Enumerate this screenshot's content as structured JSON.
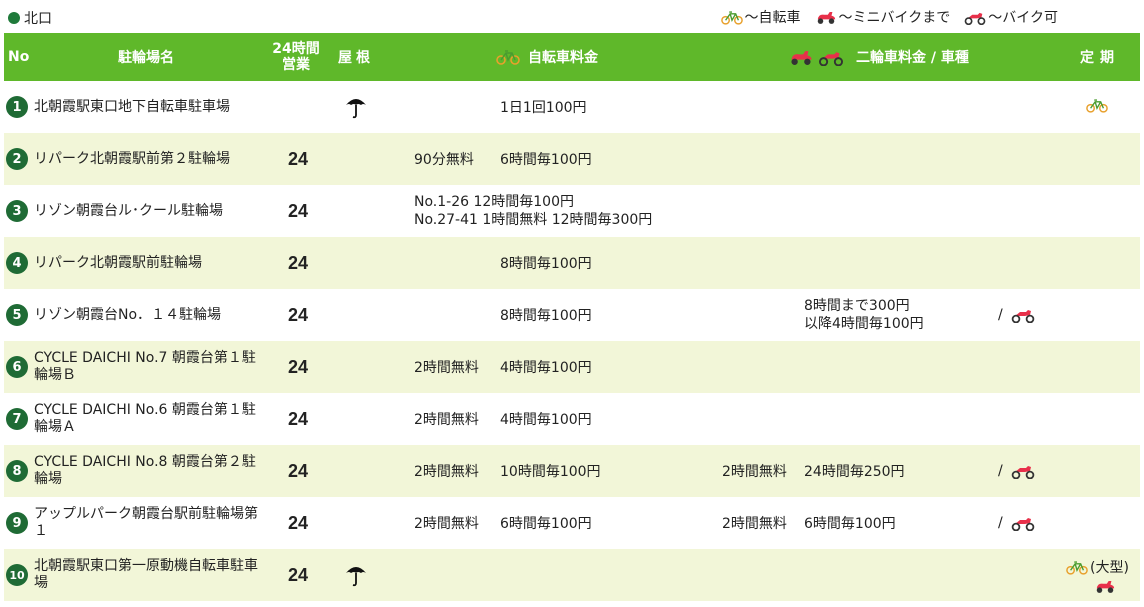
{
  "area_label": "北口",
  "legend": [
    {
      "icon": "bicycle-icon",
      "label": "～自転車"
    },
    {
      "icon": "mini-bike-icon",
      "label": "～ミニバイクまで"
    },
    {
      "icon": "motorbike-icon",
      "label": "～バイク可"
    }
  ],
  "header": {
    "no": "No",
    "name": "駐輪場名",
    "hours_line1": "24時間",
    "hours_line2": "営業",
    "roof": "屋根",
    "bicycle_fee": "自転車料金",
    "moto_fee": "二輪車料金 / 車種",
    "pass": "定期"
  },
  "colors": {
    "header_bg": "#5fb82a",
    "alt_row": "#f2f6d8",
    "number_badge": "#1f6b35",
    "accent_red": "#e8304a"
  },
  "rows": [
    {
      "no": "1",
      "name": "北朝霞駅東口地下自転車駐車場",
      "h24": "",
      "roof": true,
      "bike_fee_1": "",
      "bike_fee_2": "1日1回100円",
      "moto_fee_1": "",
      "moto_fee_2": "",
      "moto_type": "",
      "pass": "bicycle-icon"
    },
    {
      "no": "2",
      "name": "リパーク北朝霞駅前第２駐輪場",
      "h24": "24",
      "roof": false,
      "bike_fee_1": "90分無料",
      "bike_fee_2": "6時間毎100円",
      "moto_fee_1": "",
      "moto_fee_2": "",
      "moto_type": "",
      "pass": ""
    },
    {
      "no": "3",
      "name": "リゾン朝霞台ル･クール駐輪場",
      "h24": "24",
      "roof": false,
      "bike_fee_line1": "No.1-26 12時間毎100円",
      "bike_fee_line2": "No.27-41 1時間無料 12時間毎300円",
      "moto_fee_1": "",
      "moto_fee_2": "",
      "moto_type": "",
      "pass": ""
    },
    {
      "no": "4",
      "name": "リパーク北朝霞駅前駐輪場",
      "h24": "24",
      "roof": false,
      "bike_fee_1": "",
      "bike_fee_2": "8時間毎100円",
      "moto_fee_1": "",
      "moto_fee_2": "",
      "moto_type": "",
      "pass": ""
    },
    {
      "no": "5",
      "name": "リゾン朝霞台No．１４駐輪場",
      "h24": "24",
      "roof": false,
      "bike_fee_1": "",
      "bike_fee_2": "8時間毎100円",
      "moto_fee_line1": "8時間まで300円",
      "moto_fee_line2": "以降4時間毎100円",
      "moto_type": "/",
      "moto_icon": "motorbike-icon",
      "pass": ""
    },
    {
      "no": "6",
      "name": "CYCLE DAICHI No.7 朝霞台第１駐輪場Ｂ",
      "h24": "24",
      "roof": false,
      "bike_fee_1": "2時間無料",
      "bike_fee_2": "4時間毎100円",
      "moto_fee_1": "",
      "moto_fee_2": "",
      "moto_type": "",
      "pass": ""
    },
    {
      "no": "7",
      "name": "CYCLE DAICHI No.6 朝霞台第１駐輪場Ａ",
      "h24": "24",
      "roof": false,
      "bike_fee_1": "2時間無料",
      "bike_fee_2": "4時間毎100円",
      "moto_fee_1": "",
      "moto_fee_2": "",
      "moto_type": "",
      "pass": ""
    },
    {
      "no": "8",
      "name": "CYCLE DAICHI No.8 朝霞台第２駐輪場",
      "h24": "24",
      "roof": false,
      "bike_fee_1": "2時間無料",
      "bike_fee_2": "10時間毎100円",
      "moto_fee_1": "2時間無料",
      "moto_fee_2": "24時間毎250円",
      "moto_type": "/",
      "moto_icon": "motorbike-icon",
      "pass": ""
    },
    {
      "no": "9",
      "name": "アップルパーク朝霞台駅前駐輪場第１",
      "h24": "24",
      "roof": false,
      "bike_fee_1": "2時間無料",
      "bike_fee_2": "6時間毎100円",
      "moto_fee_1": "2時間無料",
      "moto_fee_2": "6時間毎100円",
      "moto_type": "/",
      "moto_icon": "motorbike-icon",
      "pass": ""
    },
    {
      "no": "10",
      "name": "北朝霞駅東口第一原動機自転車駐車場",
      "h24": "24",
      "roof": true,
      "bike_fee_1": "",
      "bike_fee_2": "",
      "moto_fee_1": "",
      "moto_fee_2": "",
      "moto_type": "",
      "pass_note": "(大型)"
    }
  ]
}
